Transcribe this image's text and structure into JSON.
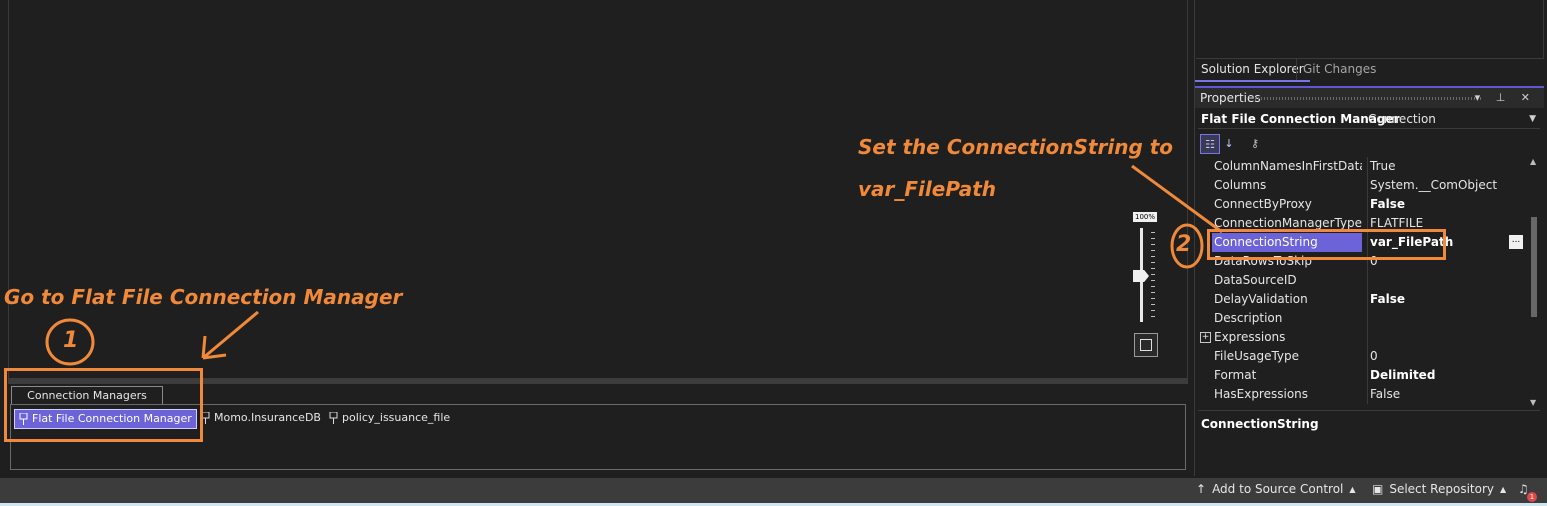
{
  "connection_managers": {
    "tab_label": "Connection Managers",
    "items": [
      {
        "label": "Flat File Connection Manager",
        "selected": true
      },
      {
        "label": "Momo.InsuranceDB",
        "selected": false
      },
      {
        "label": "policy_issuance_file",
        "selected": false
      }
    ]
  },
  "zoom": {
    "level_label": "100%"
  },
  "solution_tabs": {
    "active": "Solution Explorer",
    "inactive": "Git Changes"
  },
  "properties": {
    "panel_title": "Properties",
    "header_buttons": "▾ ⊥ ✕",
    "object_name": "Flat File Connection Manager",
    "object_type": "Connection",
    "rows": [
      {
        "name": "ColumnNamesInFirstDataRow",
        "value": "True",
        "bold": false
      },
      {
        "name": "Columns",
        "value": "System.__ComObject",
        "bold": false
      },
      {
        "name": "ConnectByProxy",
        "value": "False",
        "bold": true
      },
      {
        "name": "ConnectionManagerType",
        "value": "FLATFILE",
        "bold": false
      },
      {
        "name": "ConnectionString",
        "value": "var_FilePath",
        "bold": true,
        "selected": true
      },
      {
        "name": "DataRowsToSkip",
        "value": "0",
        "bold": false
      },
      {
        "name": "DataSourceID",
        "value": "",
        "bold": false
      },
      {
        "name": "DelayValidation",
        "value": "False",
        "bold": true
      },
      {
        "name": "Description",
        "value": "",
        "bold": false
      },
      {
        "name": "Expressions",
        "value": "",
        "bold": false,
        "expandable": true
      },
      {
        "name": "FileUsageType",
        "value": "0",
        "bold": false
      },
      {
        "name": "Format",
        "value": "Delimited",
        "bold": true
      },
      {
        "name": "HasExpressions",
        "value": "False",
        "bold": false
      }
    ],
    "description_title": "ConnectionString"
  },
  "status_bar": {
    "source_control": "Add to Source Control",
    "repository": "Select Repository",
    "notifications_count": "1"
  },
  "annotations": {
    "step1_text": "Go to Flat File Connection Manager",
    "step1_number": "1",
    "step2_line1": "Set the ConnectionString to",
    "step2_line2": "var_FilePath",
    "step2_number": "2"
  },
  "colors": {
    "accent": "#6c63d8",
    "annotation": "#f08a3a"
  }
}
